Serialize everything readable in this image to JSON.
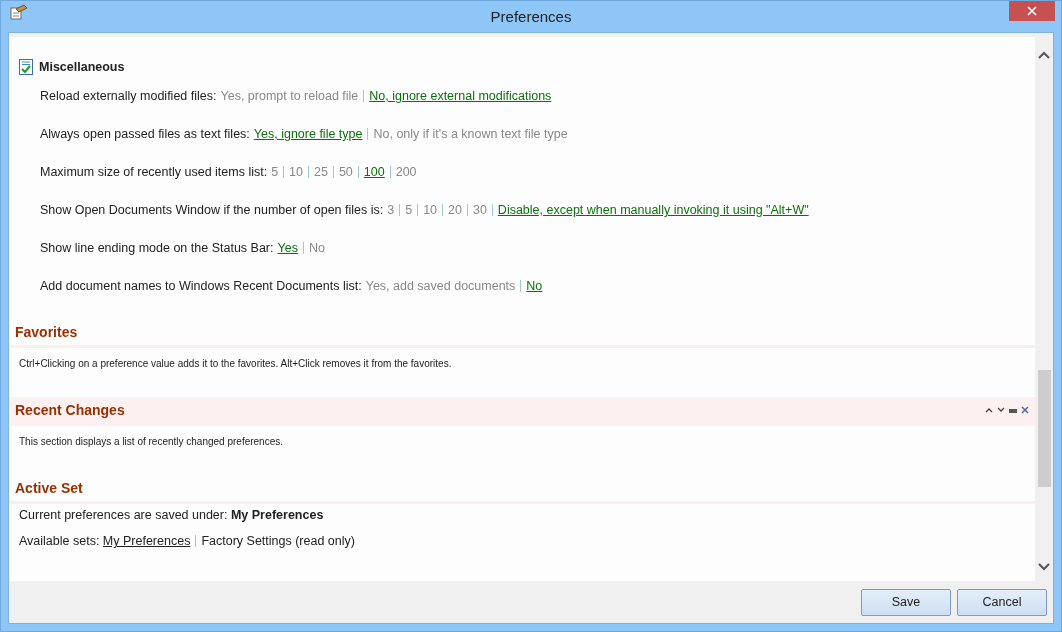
{
  "window": {
    "title": "Preferences"
  },
  "miscellaneous": {
    "title": "Miscellaneous",
    "checked": true,
    "preferences": [
      {
        "label": "Reload externally modified files:",
        "options": [
          {
            "text": "Yes, prompt to reload file",
            "selected": false
          },
          {
            "text": "No, ignore external modifications",
            "selected": true
          }
        ]
      },
      {
        "label": "Always open passed files as text files:",
        "options": [
          {
            "text": "Yes, ignore file type",
            "selected": true
          },
          {
            "text": "No, only if it's a known text file type",
            "selected": false
          }
        ]
      },
      {
        "label": "Maximum size of recently used items list:",
        "options": [
          {
            "text": "5",
            "selected": false
          },
          {
            "text": "10",
            "selected": false
          },
          {
            "text": "25",
            "selected": false
          },
          {
            "text": "50",
            "selected": false
          },
          {
            "text": "100",
            "selected": true
          },
          {
            "text": "200",
            "selected": false
          }
        ]
      },
      {
        "label": "Show Open Documents Window if the number of open files is:",
        "options": [
          {
            "text": "3",
            "selected": false
          },
          {
            "text": "5",
            "selected": false
          },
          {
            "text": "10",
            "selected": false
          },
          {
            "text": "20",
            "selected": false
          },
          {
            "text": "30",
            "selected": false
          },
          {
            "text": "Disable, except when manually invoking it using \"Alt+W\"",
            "selected": true
          }
        ]
      },
      {
        "label": "Show line ending mode on the Status Bar:",
        "options": [
          {
            "text": "Yes",
            "selected": true
          },
          {
            "text": "No",
            "selected": false
          }
        ]
      },
      {
        "label": "Add document names to Windows Recent Documents list:",
        "options": [
          {
            "text": "Yes, add saved documents",
            "selected": false
          },
          {
            "text": "No",
            "selected": true
          }
        ]
      }
    ]
  },
  "favorites": {
    "title": "Favorites",
    "highlighted": false,
    "text": "Ctrl+Clicking on a preference value adds it to the favorites. Alt+Click removes it from the favorites."
  },
  "recent_changes": {
    "title": "Recent Changes",
    "highlighted": true,
    "text": "This section displays a list of recently changed preferences."
  },
  "active_set": {
    "title": "Active Set",
    "highlighted": false,
    "current": "Current preferences are saved under: **My Preferences**",
    "sets_label": "Available sets:",
    "sets": [
      {
        "text": "My Preferences",
        "selected": true
      },
      {
        "text": "Factory Settings (read only)",
        "selected": false
      }
    ]
  },
  "buttons": [
    "Save",
    "Cancel"
  ]
}
